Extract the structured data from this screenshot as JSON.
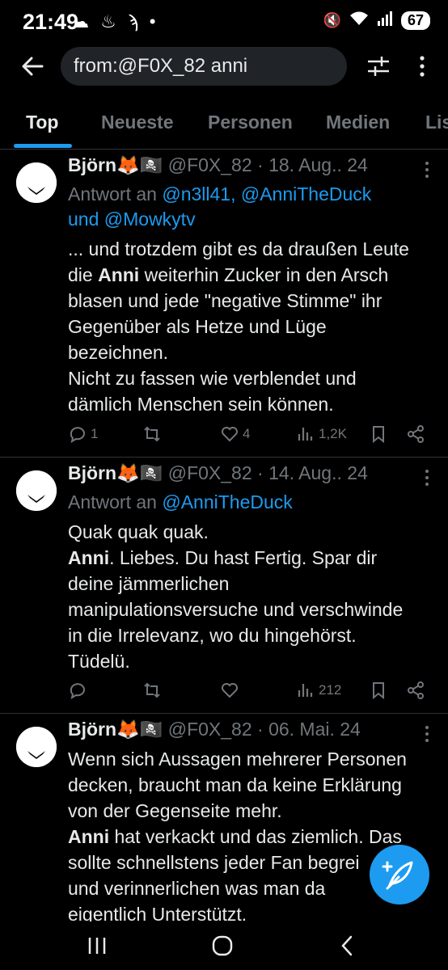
{
  "status": {
    "time": "21:49",
    "battery": "67"
  },
  "search": {
    "query": "from:@F0X_82 anni"
  },
  "tabs": [
    "Top",
    "Neueste",
    "Personen",
    "Medien",
    "Lis"
  ],
  "tweets": [
    {
      "name": "Björn🦊🏴‍☠️",
      "meta": "@F0X_82 · 18. Aug.. 24",
      "reply_prefix": "Antwort an",
      "reply_mentions": "@n3ll41, @AnniTheDuck",
      "reply_and": "und",
      "reply_mentions2": "@Mowkytv",
      "text_lines": [
        "... und trotzdem gibt es da draußen Leute",
        [
          "die ",
          "Anni",
          " weiterhin Zucker in den Arsch"
        ],
        "blasen und jede \"negative Stimme\" ihr",
        "Gegenüber als Hetze und Lüge",
        "bezeichnen.",
        "Nicht zu fassen wie verblendet und",
        "dämlich Menschen sein können."
      ],
      "replies": "1",
      "retweets": "",
      "likes": "4",
      "views": "1,2K"
    },
    {
      "name": "Björn🦊🏴‍☠️",
      "meta": "@F0X_82 · 14. Aug.. 24",
      "reply_prefix": "Antwort an",
      "reply_mentions": "@AnniTheDuck",
      "text_lines": [
        "Quak quak quak.",
        [
          "",
          "Anni",
          ". Liebes. Du hast Fertig. Spar dir"
        ],
        "deine jämmerlichen",
        "manipulationsversuche und verschwinde",
        "in die Irrelevanz, wo du hingehörst.",
        "Tüdelü."
      ],
      "replies": "",
      "retweets": "",
      "likes": "",
      "views": "212"
    },
    {
      "name": "Björn🦊🏴‍☠️",
      "meta": "@F0X_82 · 06. Mai. 24",
      "text_lines": [
        "Wenn sich Aussagen mehrerer Personen",
        "decken, braucht man da keine Erklärung",
        "von der Gegenseite mehr.",
        [
          "",
          "Anni",
          " hat verkackt und das ziemlich. Das"
        ],
        "sollte schnellstens jeder Fan begrei",
        "und verinnerlichen was man da",
        "eigentlich Unterstützt."
      ]
    }
  ],
  "colors": {
    "accent": "#1d9bf0",
    "muted": "#71767b",
    "bg": "#000000"
  }
}
